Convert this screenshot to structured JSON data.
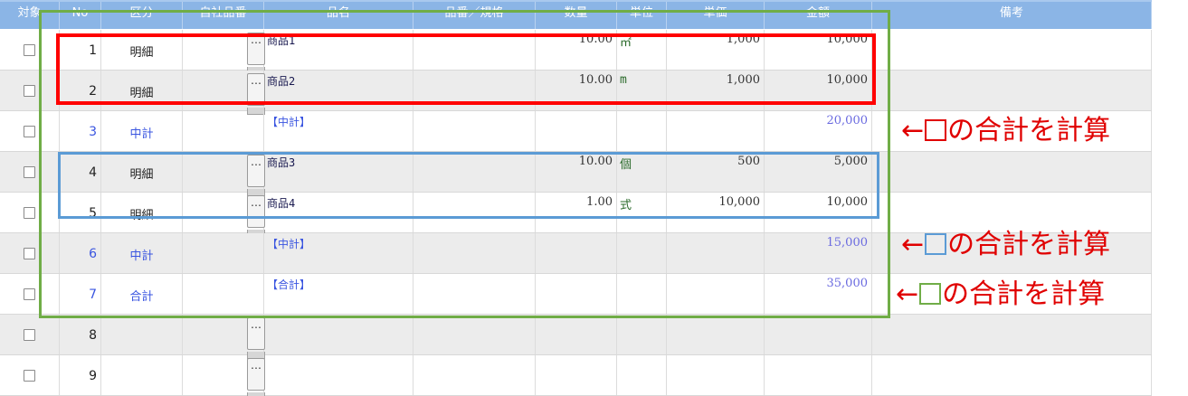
{
  "columns": [
    "対象",
    "No",
    "区分",
    "自社品番",
    "品名",
    "品番／規格",
    "数量",
    "単位",
    "単価",
    "金額",
    "備考"
  ],
  "rows": [
    {
      "no": "1",
      "kubun": "明細",
      "dots": true,
      "name": "商品1",
      "qty": "10.00",
      "unit": "㎡",
      "price": "1,000",
      "amount": "10,000",
      "type": "detail"
    },
    {
      "no": "2",
      "kubun": "明細",
      "dots": true,
      "name": "商品2",
      "qty": "10.00",
      "unit": "m",
      "price": "1,000",
      "amount": "10,000",
      "type": "detail"
    },
    {
      "no": "3",
      "kubun": "中計",
      "dots": false,
      "name": "【中計】",
      "qty": "",
      "unit": "",
      "price": "",
      "amount": "20,000",
      "type": "subtotal"
    },
    {
      "no": "4",
      "kubun": "明細",
      "dots": true,
      "name": "商品3",
      "qty": "10.00",
      "unit": "個",
      "price": "500",
      "amount": "5,000",
      "type": "detail"
    },
    {
      "no": "5",
      "kubun": "明細",
      "dots": true,
      "name": "商品4",
      "qty": "1.00",
      "unit": "式",
      "price": "10,000",
      "amount": "10,000",
      "type": "detail"
    },
    {
      "no": "6",
      "kubun": "中計",
      "dots": false,
      "name": "【中計】",
      "qty": "",
      "unit": "",
      "price": "",
      "amount": "15,000",
      "type": "subtotal"
    },
    {
      "no": "7",
      "kubun": "合計",
      "dots": false,
      "name": "【合計】",
      "qty": "",
      "unit": "",
      "price": "",
      "amount": "35,000",
      "type": "total"
    },
    {
      "no": "8",
      "kubun": "",
      "dots": true,
      "name": "",
      "qty": "",
      "unit": "",
      "price": "",
      "amount": "",
      "type": "empty"
    },
    {
      "no": "9",
      "kubun": "",
      "dots": true,
      "name": "",
      "qty": "",
      "unit": "",
      "price": "",
      "amount": "",
      "type": "empty"
    }
  ],
  "dots_label": "…",
  "annotations": [
    {
      "arrow": "←",
      "text": "の合計を計算",
      "color": "#e00000",
      "square_color": "#e00000"
    },
    {
      "arrow": "←",
      "text": "の合計を計算",
      "color": "#e00000",
      "square_color": "#5b9bd5"
    },
    {
      "arrow": "←",
      "text": "の合計を計算",
      "color": "#e00000",
      "square_color": "#70ad47"
    }
  ],
  "colors": {
    "header_bg": "#8bb5e6",
    "alt_row_bg": "#ececec",
    "red_frame": "#ff0000",
    "blue_frame": "#5b9bd5",
    "green_frame": "#70ad47",
    "subtotal_text": "#3a55e0"
  }
}
